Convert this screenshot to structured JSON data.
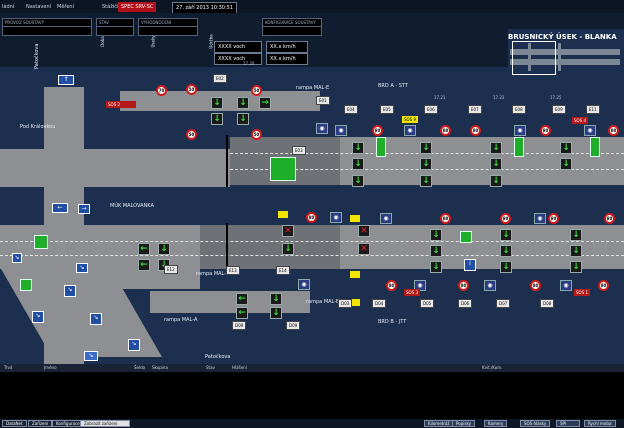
{
  "menu": {
    "items": [
      "ládní",
      "Nastavení",
      "Měření"
    ],
    "status": "Stážiči",
    "alarm": "SPEC SRV-SC",
    "datetime": "27. září 2013   10:30:51"
  },
  "toolbar": {
    "panels": [
      "PROVOZ SOUSTAVY",
      "STAV",
      "VYHODNOCENÍ",
      "KONFIGURACE SOUSTAVY"
    ],
    "labels": [
      "Doba",
      "Úseky",
      "Údržba"
    ],
    "values": [
      "XXXX voch",
      "XX.x km/h",
      "XXXX voch",
      "XX.x km/h"
    ]
  },
  "title": "BRUSNICKÝ ÚSEK - BLANKA",
  "map": {
    "labels": {
      "brd_a": "BRD A - STT",
      "brd_b": "BRD B - JTT",
      "patockova_top": "Patočkova",
      "patockova_bottom": "Patočkova",
      "pod_kralovkou": "Pod Královkou",
      "mrk": "MÚK MALOVANKA",
      "rampa_e": "rampa MAL-E",
      "rampa_c": "rampa MAL-C",
      "rampa_a": "rampa MAL-A",
      "rampa_b": "rampa MAL-B"
    },
    "km": [
      "17.20",
      "17.21",
      "17.23",
      "17.25"
    ],
    "tags": [
      "E02",
      "E01",
      "E03",
      "E04",
      "E05",
      "E06",
      "E07",
      "E08",
      "E09",
      "E11",
      "E12",
      "E13",
      "E14",
      "D03",
      "D04",
      "D05",
      "D06",
      "D07",
      "D08",
      "D09"
    ],
    "sos": [
      "SOS 4",
      "SOS 3",
      "SOS 1",
      "SOS 2"
    ],
    "yellow": [
      "SOS 9"
    ],
    "speed": [
      "50",
      "70",
      "80"
    ]
  },
  "events": {
    "columns": [
      "Trvá",
      "Jméno",
      "Šelda",
      "Skupina",
      "Stav",
      "Hlášení",
      "Kvit./Kom."
    ]
  },
  "footer": {
    "left": [
      "DataNet",
      "Zařízení",
      "Konfigurace"
    ],
    "show_button": "Zobrazit zařízení",
    "buttons": [
      "Kilometráž",
      "Popisky",
      "Kamery",
      "SOS hlásky",
      "SPI",
      "Rychl motor"
    ]
  }
}
